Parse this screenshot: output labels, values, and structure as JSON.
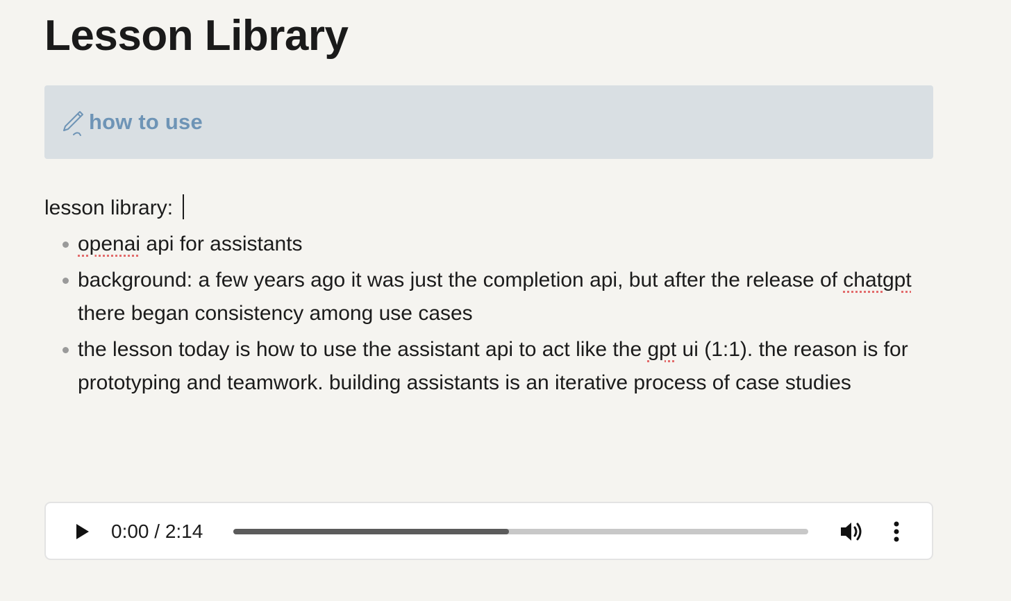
{
  "page": {
    "title": "Lesson Library"
  },
  "callout": {
    "icon": "pencil-icon",
    "link_label": "how to use"
  },
  "content": {
    "heading": "lesson library:",
    "bullets": [
      {
        "segments": [
          {
            "text": "openai",
            "misspelled": true
          },
          {
            "text": " api for assistants",
            "misspelled": false
          }
        ]
      },
      {
        "segments": [
          {
            "text": "background: a few years ago it was just the completion api, but after the release of ",
            "misspelled": false
          },
          {
            "text": "chatgpt",
            "misspelled": true
          },
          {
            "text": " there began consistency among use cases",
            "misspelled": false
          }
        ]
      },
      {
        "segments": [
          {
            "text": "the lesson today is how to use the assistant api to act like the ",
            "misspelled": false
          },
          {
            "text": "gpt",
            "misspelled": true
          },
          {
            "text": " ui (1:1). the reason is for prototyping and teamwork. building assistants is an iterative process of case studies",
            "misspelled": false
          }
        ]
      }
    ]
  },
  "audio_player": {
    "time_label": "0:00 / 2:14",
    "progress_fraction": 0.48,
    "play_icon": "play-icon",
    "volume_icon": "volume-icon",
    "more_icon": "more-vertical-icon"
  },
  "colors": {
    "background": "#f5f4f0",
    "callout_background": "#d9dfe3",
    "callout_link": "#6e94b6",
    "spellcheck_underline": "#e26b6b"
  }
}
